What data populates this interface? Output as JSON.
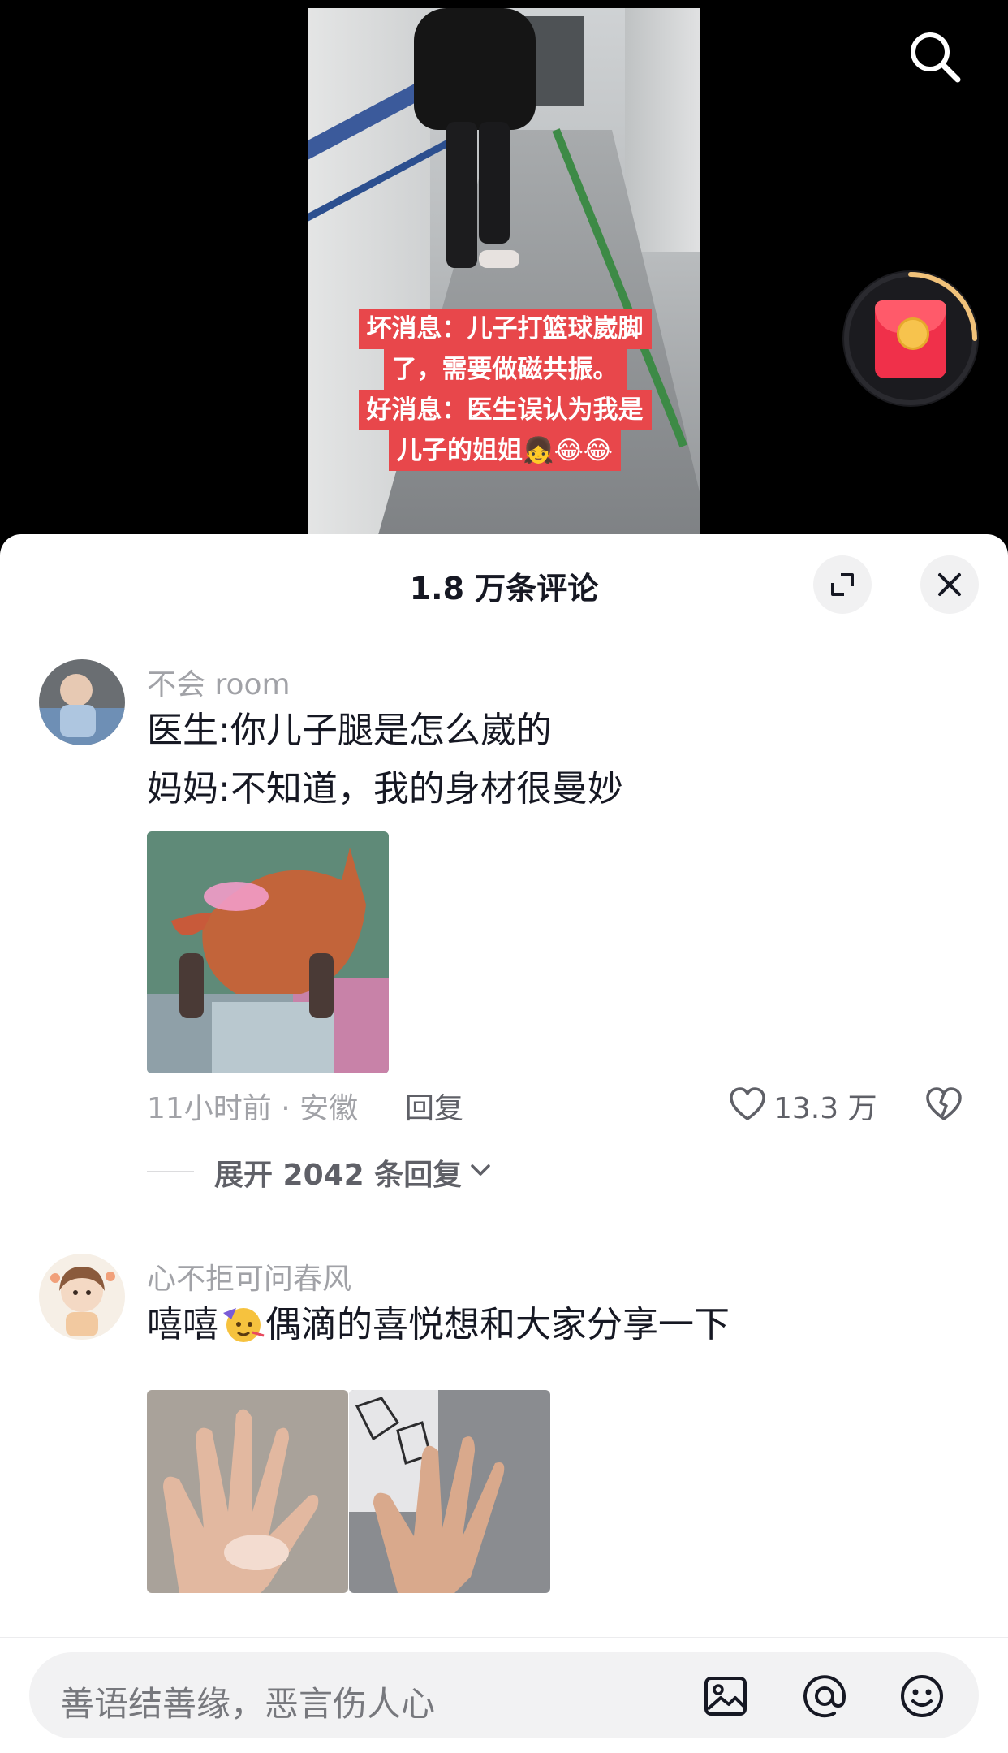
{
  "video": {
    "caption_lines": [
      "坏消息：儿子打篮球崴脚",
      "了，需要做磁共振。",
      "好消息：医生误认为我是",
      "儿子的姐姐"
    ],
    "caption_emojis": [
      "👧",
      "😂",
      "😂"
    ],
    "icons": {
      "search": "search-icon",
      "redpacket": "red-envelope-icon"
    },
    "accent_color": "#e8474b"
  },
  "comments_panel": {
    "title": "1.8 万条评论",
    "icons": {
      "expand": "expand-icon",
      "close": "close-icon"
    }
  },
  "comments": [
    {
      "username": "不会 room",
      "lines": [
        "医生:你儿子腿是怎么崴的",
        "妈妈:不知道，我的身材很曼妙"
      ],
      "time_location": "11小时前 · 安徽",
      "reply_label": "回复",
      "like_count": "13.3 万",
      "expand_replies": "展开 2042 条回复"
    },
    {
      "username": "心不拒可问春风",
      "text_before_emoji": "嘻嘻",
      "emoji": "🥳",
      "text_after_emoji": "偶滴的喜悦想和大家分享一下"
    }
  ],
  "input_bar": {
    "placeholder": "善语结善缘，恶言伤人心",
    "icons": [
      "image-icon",
      "at-icon",
      "emoji-icon"
    ]
  }
}
